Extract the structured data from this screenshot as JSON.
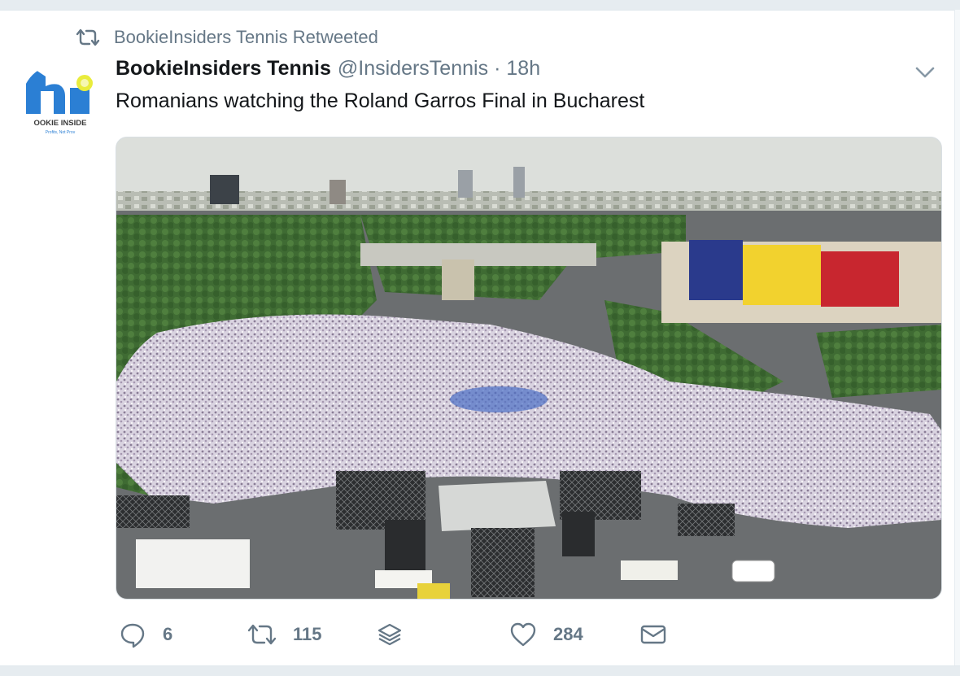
{
  "retweet_context": {
    "text": "BookieInsiders Tennis Retweeted",
    "icon": "retweet-icon"
  },
  "tweet": {
    "author_name": "BookieInsiders Tennis",
    "handle": "@InsidersTennis",
    "separator": "·",
    "time": "18h",
    "text": "Romanians watching the Roland Garros Final in Bucharest",
    "avatar": {
      "logo_text": "OOKIE INSIDE",
      "tagline": "Profits, Not Prov"
    },
    "media": {
      "description_icon": "photo",
      "flag_colors": [
        "#2a3a8c",
        "#f2d22e",
        "#c8262f"
      ]
    }
  },
  "actions": {
    "reply": {
      "icon": "reply-icon",
      "count": "6"
    },
    "retweet": {
      "icon": "retweet-icon",
      "count": "115"
    },
    "stack": {
      "icon": "layers-icon"
    },
    "like": {
      "icon": "heart-icon",
      "count": "284"
    },
    "dm": {
      "icon": "envelope-icon"
    }
  },
  "colors": {
    "muted": "#657786",
    "text": "#14171a",
    "brand_blue": "#2b7fd4"
  }
}
